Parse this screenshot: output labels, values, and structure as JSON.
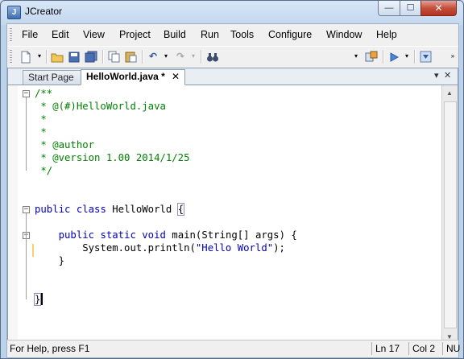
{
  "window": {
    "title": "JCreator",
    "app_icon": "J",
    "min_glyph": "—",
    "max_glyph": "☐",
    "close_glyph": "✕"
  },
  "menu": {
    "items": [
      "File",
      "Edit",
      "View",
      "Project",
      "Build",
      "Run",
      "Tools",
      "Configure",
      "Window",
      "Help"
    ],
    "mnemonic_underline": [
      0,
      0,
      0,
      0,
      0,
      0,
      0,
      0,
      0,
      0
    ]
  },
  "toolbar": {
    "icons": [
      "new-file-icon",
      "open-folder-icon",
      "save-icon",
      "save-all-icon",
      "copy-icon",
      "paste-icon",
      "undo-icon",
      "redo-icon",
      "find-icon",
      "build-icon",
      "run-icon",
      "debug-icon"
    ]
  },
  "tabs": [
    {
      "label": "Start Page",
      "active": false
    },
    {
      "label": "HelloWorld.java *",
      "active": true,
      "close": "✕"
    }
  ],
  "tabstrip": {
    "nav_glyph": "▾",
    "close_glyph": "✕"
  },
  "code": [
    {
      "fold": "−",
      "parts": [
        [
          "c",
          "/**"
        ]
      ]
    },
    {
      "parts": [
        [
          "c",
          " * @(#)HelloWorld.java"
        ]
      ]
    },
    {
      "parts": [
        [
          "c",
          " *"
        ]
      ]
    },
    {
      "parts": [
        [
          "c",
          " *"
        ]
      ]
    },
    {
      "parts": [
        [
          "c",
          " * @author"
        ]
      ]
    },
    {
      "parts": [
        [
          "c",
          " * @version 1.00 2014/1/25"
        ]
      ]
    },
    {
      "parts": [
        [
          "c",
          " */"
        ]
      ]
    },
    {
      "parts": []
    },
    {
      "parts": []
    },
    {
      "fold": "−",
      "parts": [
        [
          "k",
          "public"
        ],
        [
          "t",
          " "
        ],
        [
          "k",
          "class"
        ],
        [
          "t",
          " HelloWorld "
        ],
        [
          "b",
          "{"
        ]
      ]
    },
    {
      "parts": []
    },
    {
      "fold": "−",
      "parts": [
        [
          "t",
          "    "
        ],
        [
          "k",
          "public"
        ],
        [
          "t",
          " "
        ],
        [
          "k",
          "static"
        ],
        [
          "t",
          " "
        ],
        [
          "k",
          "void"
        ],
        [
          "t",
          " main(String[] args) {"
        ]
      ]
    },
    {
      "parts": [
        [
          "t",
          "        System.out.println("
        ],
        [
          "s",
          "\"Hello World\""
        ],
        [
          "t",
          ");"
        ]
      ]
    },
    {
      "parts": [
        [
          "t",
          "    }"
        ]
      ]
    },
    {
      "parts": []
    },
    {
      "parts": []
    },
    {
      "parts": [
        [
          "b",
          "}"
        ]
      ]
    }
  ],
  "status": {
    "help": "For Help, press F1",
    "line": "Ln 17",
    "col": "Col 2",
    "mode": "NU"
  }
}
